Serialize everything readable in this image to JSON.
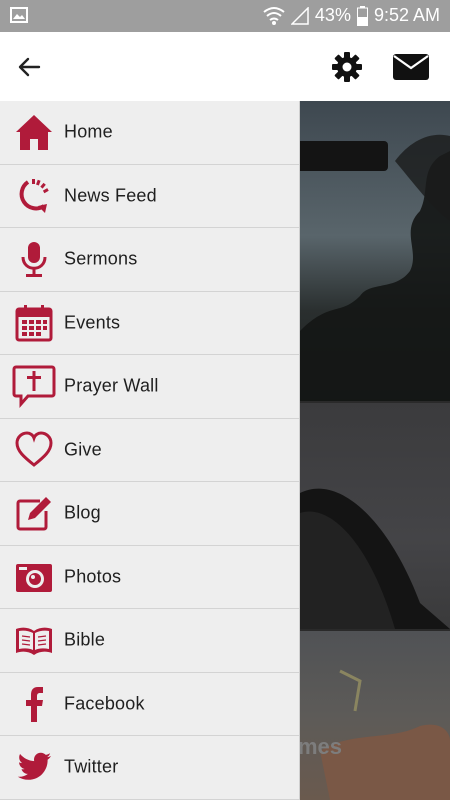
{
  "status_bar": {
    "battery": "43%",
    "time": "9:52 AM"
  },
  "colors": {
    "accent": "#b01b3a",
    "drawer_bg": "#eeeeee",
    "status_bar_bg": "#9e9e9e"
  },
  "app_bar": {
    "icons": [
      "back-arrow-icon",
      "gear-icon",
      "mail-icon"
    ]
  },
  "menu": {
    "items": [
      {
        "label": "Home",
        "icon": "home-icon"
      },
      {
        "label": "News Feed",
        "icon": "news-feed-icon"
      },
      {
        "label": "Sermons",
        "icon": "microphone-icon"
      },
      {
        "label": "Events",
        "icon": "calendar-icon"
      },
      {
        "label": "Prayer Wall",
        "icon": "prayer-wall-icon"
      },
      {
        "label": "Give",
        "icon": "heart-icon"
      },
      {
        "label": "Blog",
        "icon": "blog-icon"
      },
      {
        "label": "Photos",
        "icon": "camera-icon"
      },
      {
        "label": "Bible",
        "icon": "bible-icon"
      },
      {
        "label": "Facebook",
        "icon": "facebook-icon"
      },
      {
        "label": "Twitter",
        "icon": "twitter-icon"
      }
    ]
  },
  "background": {
    "card3_text": "mes"
  }
}
